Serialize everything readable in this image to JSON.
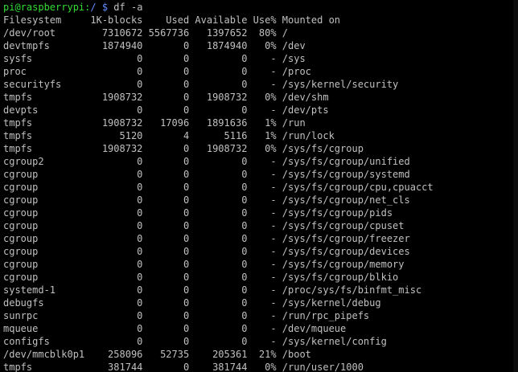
{
  "prompt": {
    "user_host": "pi@raspberrypi",
    "separator": ":",
    "path": "/ $",
    "command": " df -a"
  },
  "header": "Filesystem     1K-blocks    Used Available Use% Mounted on",
  "rows": [
    "/dev/root        7310672 5567736   1397652  80% /",
    "devtmpfs         1874940       0   1874940   0% /dev",
    "sysfs                  0       0         0    - /sys",
    "proc                   0       0         0    - /proc",
    "securityfs             0       0         0    - /sys/kernel/security",
    "tmpfs            1908732       0   1908732   0% /dev/shm",
    "devpts                 0       0         0    - /dev/pts",
    "tmpfs            1908732   17096   1891636   1% /run",
    "tmpfs               5120       4      5116   1% /run/lock",
    "tmpfs            1908732       0   1908732   0% /sys/fs/cgroup",
    "cgroup2                0       0         0    - /sys/fs/cgroup/unified",
    "cgroup                 0       0         0    - /sys/fs/cgroup/systemd",
    "cgroup                 0       0         0    - /sys/fs/cgroup/cpu,cpuacct",
    "cgroup                 0       0         0    - /sys/fs/cgroup/net_cls",
    "cgroup                 0       0         0    - /sys/fs/cgroup/pids",
    "cgroup                 0       0         0    - /sys/fs/cgroup/cpuset",
    "cgroup                 0       0         0    - /sys/fs/cgroup/freezer",
    "cgroup                 0       0         0    - /sys/fs/cgroup/devices",
    "cgroup                 0       0         0    - /sys/fs/cgroup/memory",
    "cgroup                 0       0         0    - /sys/fs/cgroup/blkio",
    "systemd-1              0       0         0    - /proc/sys/fs/binfmt_misc",
    "debugfs                0       0         0    - /sys/kernel/debug",
    "sunrpc                 0       0         0    - /run/rpc_pipefs",
    "mqueue                 0       0         0    - /dev/mqueue",
    "configfs               0       0         0    - /sys/kernel/config",
    "/dev/mmcblk0p1    258096   52735    205361  21% /boot",
    "tmpfs             381744       0    381744   0% /run/user/1000"
  ],
  "colors": {
    "background": "#000000",
    "text": "#c0c0c0",
    "prompt_user": "#33dd33",
    "prompt_path": "#5c8cff"
  }
}
